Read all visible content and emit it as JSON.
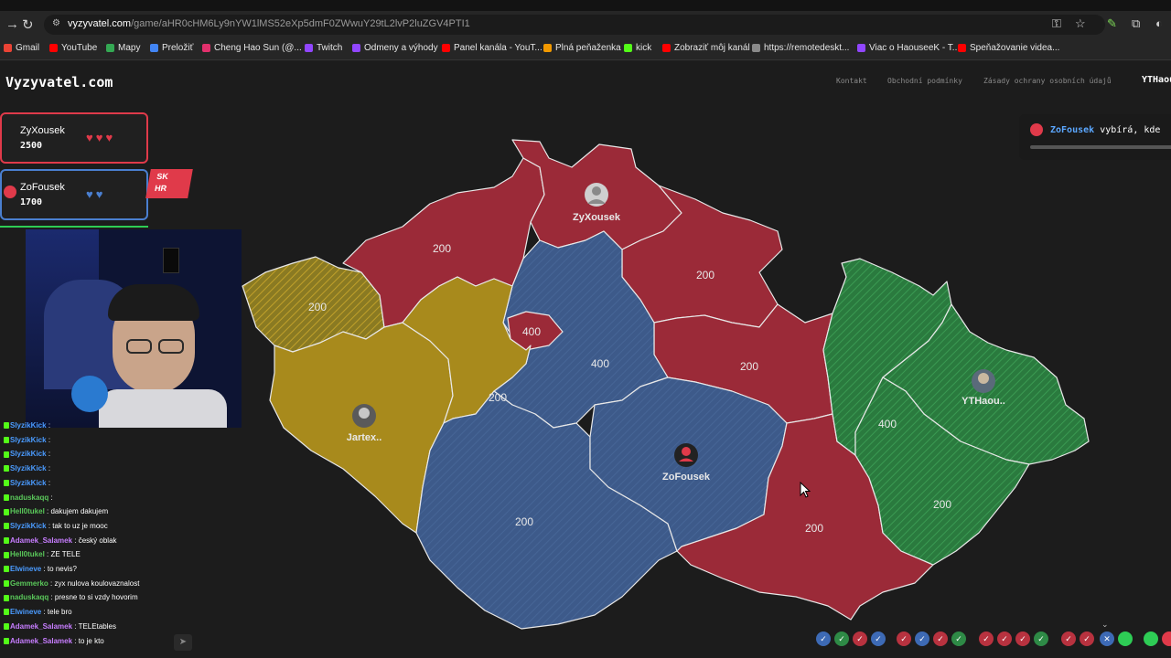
{
  "browser": {
    "url_host": "vyzyvatel.com",
    "url_path": "/game/aHR0cHM6Ly9nYW1lMS52eXp5dmF0ZWwuY29tL2lvP2luZGV4PTI1",
    "bookmarks": [
      {
        "label": "Gmail",
        "color": "#ea4335"
      },
      {
        "label": "YouTube",
        "color": "#ff0000"
      },
      {
        "label": "Mapy",
        "color": "#34a853"
      },
      {
        "label": "Preložiť",
        "color": "#4285f4"
      },
      {
        "label": "Cheng Hao Sun (@...",
        "color": "#e1306c"
      },
      {
        "label": "Twitch",
        "color": "#9146ff"
      },
      {
        "label": "Odmeny a výhody",
        "color": "#9146ff"
      },
      {
        "label": "Panel kanála - YouT...",
        "color": "#ff0000"
      },
      {
        "label": "Plná peňaženka",
        "color": "#f29900"
      },
      {
        "label": "kick",
        "color": "#53fc18"
      },
      {
        "label": "Zobraziť môj kanál",
        "color": "#ff0000"
      },
      {
        "label": "https://remotedeskt...",
        "color": "#8a8a8a"
      },
      {
        "label": "Viac o HaouseeK - T...",
        "color": "#9146ff"
      },
      {
        "label": "Speňažovanie videa...",
        "color": "#ff0000"
      }
    ]
  },
  "site": {
    "logo": "Vyzyvatel.com",
    "links": [
      "Kontakt",
      "Obchodní podmínky",
      "Zásady ochrany osobních údajů"
    ],
    "user": "YTHaou"
  },
  "players": [
    {
      "name": "ZyXousek",
      "score": "2500",
      "hearts": "♥♥♥",
      "color": "#e03a4a"
    },
    {
      "name": "ZoFousek",
      "score": "1700",
      "hearts": "♥♥",
      "color": "#4a7fd0"
    }
  ],
  "overlay_badge": {
    "line1": "SK",
    "line2": "HR"
  },
  "notification": {
    "who": "ZoFousek",
    "text": "vybírá, kde"
  },
  "map": {
    "labels": [
      {
        "text": "200"
      },
      {
        "text": "200"
      },
      {
        "text": "400"
      },
      {
        "text": "400"
      },
      {
        "text": "200"
      },
      {
        "text": "200"
      },
      {
        "text": "200"
      },
      {
        "text": "400"
      },
      {
        "text": "200"
      },
      {
        "text": "200"
      },
      {
        "text": "200"
      }
    ],
    "players": [
      {
        "name": "ZyXousek"
      },
      {
        "name": "Jartex.."
      },
      {
        "name": "ZoFousek"
      },
      {
        "name": "YTHaou.."
      }
    ],
    "colors": {
      "red": "#9b2a38",
      "blue": "#3d5a8a",
      "yellow": "#a88a1c",
      "green": "#2e8a46"
    }
  },
  "chat": [
    {
      "user": "SlyzikKick",
      "msg": ":",
      "color": "#4a9bff"
    },
    {
      "user": "SlyzikKick",
      "msg": ":",
      "color": "#4a9bff"
    },
    {
      "user": "SlyzikKick",
      "msg": ":",
      "color": "#4a9bff"
    },
    {
      "user": "SlyzikKick",
      "msg": ":",
      "color": "#4a9bff"
    },
    {
      "user": "SlyzikKick",
      "msg": ":",
      "color": "#4a9bff"
    },
    {
      "user": "naduskaqq",
      "msg": ":",
      "color": "#5ac85a"
    },
    {
      "user": "Hell0tukel",
      "msg": ": dakujem dakujem",
      "color": "#5ac85a"
    },
    {
      "user": "SlyzikKick",
      "msg": ": tak to uz je mooc",
      "color": "#4a9bff"
    },
    {
      "user": "Adamek_Salamek",
      "msg": ": český oblak",
      "color": "#c77dff"
    },
    {
      "user": "Hell0tukel",
      "msg": ": ZE TELE",
      "color": "#5ac85a"
    },
    {
      "user": "Elwineve",
      "msg": ": to nevis?",
      "color": "#4a9bff"
    },
    {
      "user": "Gemmerko",
      "msg": ": zyx nulova koulovaznalost",
      "color": "#5ac85a"
    },
    {
      "user": "naduskaqq",
      "msg": ": presne to si vzdy hovorim",
      "color": "#5ac85a"
    },
    {
      "user": "Elwineve",
      "msg": ": tele bro",
      "color": "#4a9bff"
    },
    {
      "user": "Adamek_Salamek",
      "msg": ": TELEtables",
      "color": "#c77dff"
    },
    {
      "user": "Adamek_Salamek",
      "msg": ": to je kto",
      "color": "#c77dff"
    }
  ],
  "progress_marks": [
    {
      "mark": "✓",
      "color": "#3d6ab5"
    },
    {
      "mark": "✓",
      "color": "#2e8a46"
    },
    {
      "mark": "✓",
      "color": "#b8323f"
    },
    {
      "mark": "✓",
      "color": "#3d6ab5"
    },
    {
      "mark": "✓",
      "color": "#b8323f"
    },
    {
      "mark": "✓",
      "color": "#3d6ab5"
    },
    {
      "mark": "✓",
      "color": "#b8323f"
    },
    {
      "mark": "✓",
      "color": "#2e8a46"
    },
    {
      "mark": "✓",
      "color": "#b8323f"
    },
    {
      "mark": "✓",
      "color": "#b8323f"
    },
    {
      "mark": "✓",
      "color": "#b8323f"
    },
    {
      "mark": "✓",
      "color": "#2e8a46"
    },
    {
      "mark": "✓",
      "color": "#b8323f"
    },
    {
      "mark": "✓",
      "color": "#b8323f"
    },
    {
      "mark": "✕",
      "color": "#3d6ab5"
    },
    {
      "mark": "",
      "color": "#2ecc55"
    },
    {
      "mark": "",
      "color": "#2ecc55"
    },
    {
      "mark": "",
      "color": "#e03a4a"
    }
  ]
}
